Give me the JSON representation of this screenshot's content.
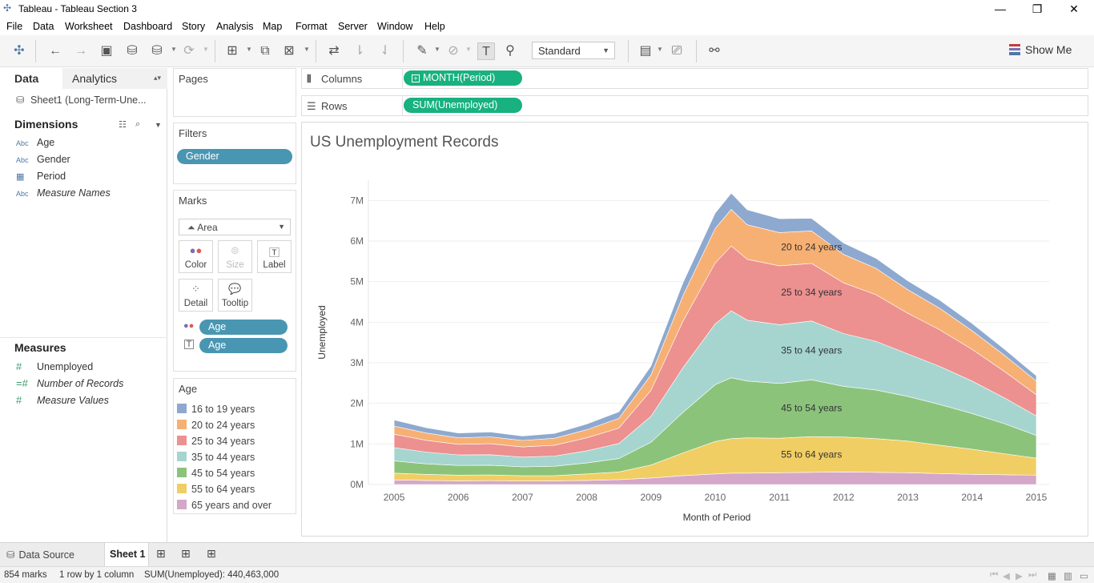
{
  "window": {
    "title": "Tableau - Tableau Section 3"
  },
  "menu": [
    "File",
    "Data",
    "Worksheet",
    "Dashboard",
    "Story",
    "Analysis",
    "Map",
    "Format",
    "Server",
    "Window",
    "Help"
  ],
  "toolbar": {
    "fit": "Standard",
    "show_me": "Show Me"
  },
  "left_tabs": {
    "data": "Data",
    "analytics": "Analytics"
  },
  "datasource": "Sheet1 (Long-Term-Une...",
  "dimensions": {
    "title": "Dimensions",
    "items": [
      {
        "type": "Abc",
        "name": "Age"
      },
      {
        "type": "Abc",
        "name": "Gender"
      },
      {
        "type": "date",
        "name": "Period"
      },
      {
        "type": "Abc",
        "name": "Measure Names"
      }
    ]
  },
  "measures": {
    "title": "Measures",
    "items": [
      {
        "type": "#",
        "name": "Unemployed"
      },
      {
        "type": "=#",
        "name": "Number of Records"
      },
      {
        "type": "#",
        "name": "Measure Values"
      }
    ]
  },
  "cards": {
    "pages": "Pages",
    "filters": {
      "title": "Filters",
      "pills": [
        "Gender"
      ]
    },
    "marks": {
      "title": "Marks",
      "type": "Area",
      "buttons": [
        "Color",
        "Size",
        "Label",
        "Detail",
        "Tooltip"
      ],
      "pills": [
        "Age",
        "Age"
      ]
    },
    "legend": {
      "title": "Age"
    }
  },
  "shelves": {
    "columns": {
      "label": "Columns",
      "pill": "MONTH(Period)"
    },
    "rows": {
      "label": "Rows",
      "pill": "SUM(Unemployed)"
    }
  },
  "chart_data": {
    "type": "area",
    "title": "US Unemployment Records",
    "xlabel": "Month of Period",
    "ylabel": "Unemployed",
    "x_ticks": [
      "2005",
      "2006",
      "2007",
      "2008",
      "2009",
      "2010",
      "2011",
      "2012",
      "2013",
      "2014",
      "2015"
    ],
    "y_ticks": [
      "0M",
      "1M",
      "2M",
      "3M",
      "4M",
      "5M",
      "6M",
      "7M"
    ],
    "ylim": [
      0,
      7500000
    ],
    "xlim": [
      2004.6,
      2015.2
    ],
    "stacked": true,
    "x": [
      2005.0,
      2005.5,
      2006.0,
      2006.5,
      2007.0,
      2007.5,
      2008.0,
      2008.5,
      2009.0,
      2009.5,
      2010.0,
      2010.25,
      2010.5,
      2011.0,
      2011.5,
      2012.0,
      2012.5,
      2013.0,
      2013.5,
      2014.0,
      2014.5,
      2015.0
    ],
    "series": [
      {
        "name": "65 years and over",
        "color": "#d4a6c8",
        "values": [
          110000,
          100000,
          90000,
          95000,
          85000,
          90000,
          100000,
          120000,
          160000,
          220000,
          260000,
          280000,
          280000,
          290000,
          300000,
          310000,
          300000,
          290000,
          270000,
          250000,
          240000,
          230000
        ]
      },
      {
        "name": "55 to 64 years",
        "color": "#f1ce63",
        "values": [
          170000,
          150000,
          140000,
          140000,
          130000,
          130000,
          160000,
          190000,
          320000,
          560000,
          800000,
          850000,
          870000,
          850000,
          880000,
          860000,
          830000,
          780000,
          700000,
          620000,
          520000,
          420000
        ]
      },
      {
        "name": "45 to 54 years",
        "color": "#8cc37b",
        "values": [
          300000,
          260000,
          240000,
          240000,
          220000,
          230000,
          270000,
          330000,
          560000,
          1000000,
          1400000,
          1500000,
          1400000,
          1350000,
          1400000,
          1250000,
          1200000,
          1100000,
          1000000,
          880000,
          740000,
          560000
        ]
      },
      {
        "name": "35 to 44 years",
        "color": "#a6d5d0",
        "values": [
          330000,
          290000,
          260000,
          260000,
          240000,
          250000,
          300000,
          370000,
          640000,
          1100000,
          1500000,
          1650000,
          1500000,
          1450000,
          1450000,
          1300000,
          1200000,
          1050000,
          940000,
          800000,
          640000,
          480000
        ]
      },
      {
        "name": "25 to 34 years",
        "color": "#ec9090",
        "values": [
          330000,
          290000,
          260000,
          270000,
          250000,
          270000,
          320000,
          380000,
          640000,
          1150000,
          1500000,
          1600000,
          1500000,
          1450000,
          1420000,
          1250000,
          1150000,
          1000000,
          900000,
          780000,
          650000,
          520000
        ]
      },
      {
        "name": "20 to 24 years",
        "color": "#f7b073",
        "values": [
          200000,
          180000,
          160000,
          170000,
          160000,
          170000,
          200000,
          240000,
          380000,
          630000,
          850000,
          900000,
          850000,
          820000,
          800000,
          700000,
          650000,
          580000,
          530000,
          460000,
          400000,
          340000
        ]
      },
      {
        "name": "16 to 19 years",
        "color": "#8ea9cf",
        "values": [
          150000,
          130000,
          120000,
          120000,
          110000,
          120000,
          140000,
          160000,
          220000,
          320000,
          380000,
          400000,
          370000,
          340000,
          310000,
          280000,
          250000,
          220000,
          200000,
          180000,
          150000,
          130000
        ]
      }
    ],
    "annotations": [
      {
        "series": "20 to 24 years",
        "text": "20 to 24 years"
      },
      {
        "series": "25 to 34 years",
        "text": "25 to 34 years"
      },
      {
        "series": "35 to 44 years",
        "text": "35 to 44 years"
      },
      {
        "series": "45 to 54 years",
        "text": "45 to 54 years"
      },
      {
        "series": "55 to 64 years",
        "text": "55 to 64 years"
      }
    ]
  },
  "legend_items": [
    {
      "name": "16 to 19 years",
      "color": "#8ea9cf"
    },
    {
      "name": "20 to 24 years",
      "color": "#f7b073"
    },
    {
      "name": "25 to 34 years",
      "color": "#ec9090"
    },
    {
      "name": "35 to 44 years",
      "color": "#a6d5d0"
    },
    {
      "name": "45 to 54 years",
      "color": "#8cc37b"
    },
    {
      "name": "55 to 64 years",
      "color": "#f1ce63"
    },
    {
      "name": "65 years and over",
      "color": "#d4a6c8"
    }
  ],
  "bottom_tabs": {
    "datasource": "Data Source",
    "sheet": "Sheet 1"
  },
  "status": {
    "marks": "854 marks",
    "dims": "1 row by 1 column",
    "sum": "SUM(Unemployed): 440,463,000"
  }
}
